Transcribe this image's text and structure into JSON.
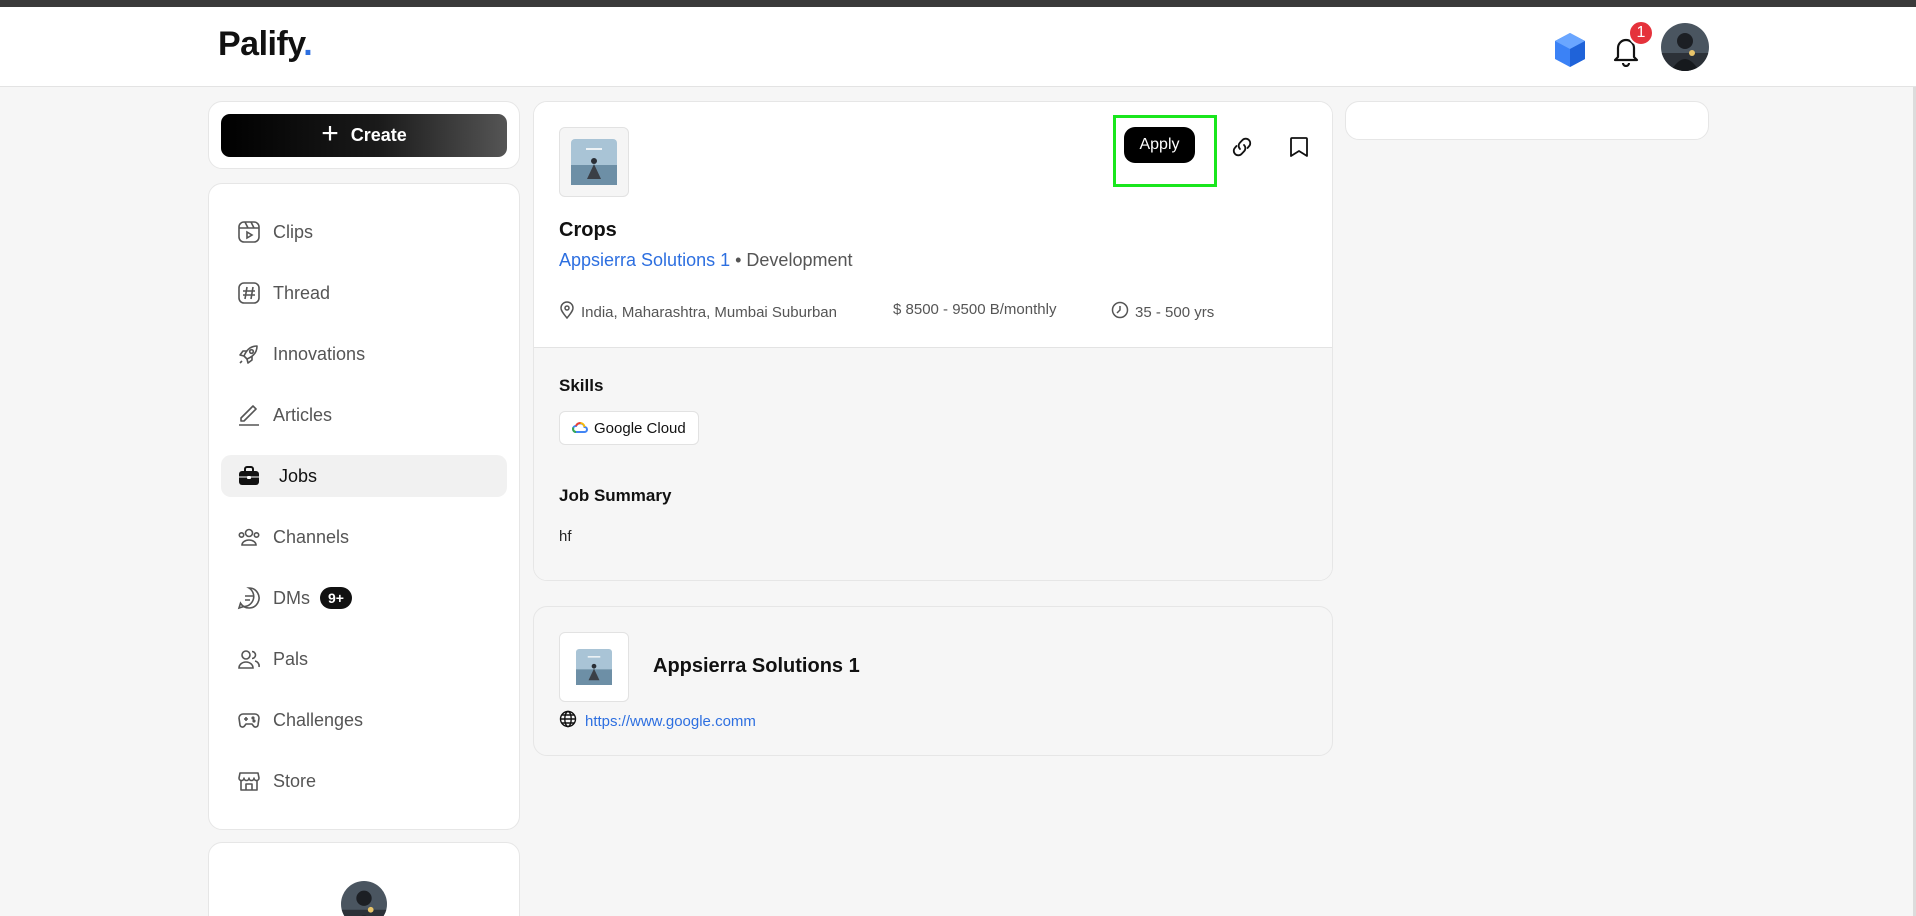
{
  "app": {
    "logo_text": "Palify",
    "logo_dot": "."
  },
  "header": {
    "notification_count": "1"
  },
  "sidebar": {
    "create_label": "Create",
    "items": [
      {
        "label": "Clips",
        "icon": "clips-icon"
      },
      {
        "label": "Thread",
        "icon": "hash-icon"
      },
      {
        "label": "Innovations",
        "icon": "rocket-icon"
      },
      {
        "label": "Articles",
        "icon": "pen-icon"
      },
      {
        "label": "Jobs",
        "icon": "briefcase-icon",
        "active": true
      },
      {
        "label": "Channels",
        "icon": "users-icon"
      },
      {
        "label": "DMs",
        "icon": "chat-icon",
        "badge": "9+"
      },
      {
        "label": "Pals",
        "icon": "pals-icon"
      },
      {
        "label": "Challenges",
        "icon": "gamepad-icon"
      },
      {
        "label": "Store",
        "icon": "store-icon"
      }
    ]
  },
  "job": {
    "apply_label": "Apply",
    "title": "Crops",
    "company": "Appsierra Solutions 1",
    "separator": " • ",
    "category": "Development",
    "location": "India, Maharashtra, Mumbai Suburban",
    "salary": "$ 8500 - 9500 B/monthly",
    "experience": "35 - 500 yrs",
    "skills_title": "Skills",
    "skills": [
      "Google Cloud"
    ],
    "summary_title": "Job Summary",
    "summary": "hf"
  },
  "company": {
    "name": "Appsierra Solutions 1",
    "website": "https://www.google.comm"
  },
  "colors": {
    "accent": "#2d6fe0",
    "highlight": "#19e61d",
    "badge": "#e5323b"
  }
}
